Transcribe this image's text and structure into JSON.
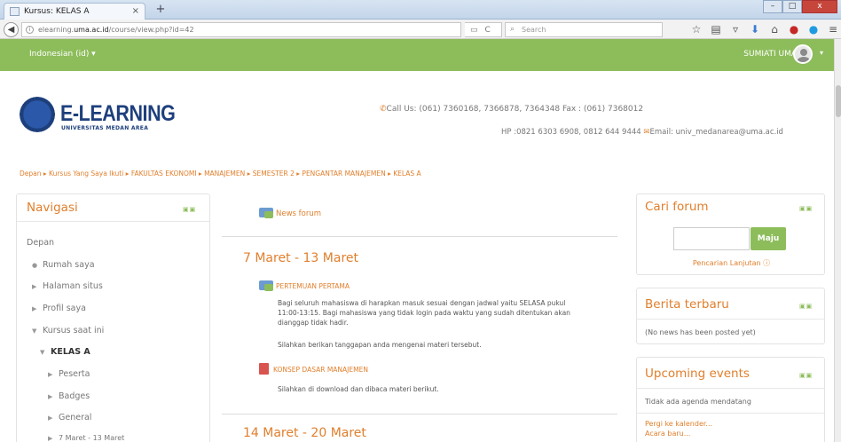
{
  "browser": {
    "tab_title": "Kursus: KELAS A",
    "tab_close": "×",
    "new_tab": "+",
    "url_prefix": "elearning.",
    "url_domain": "uma.ac.id",
    "url_path": "/course/view.php?id=42",
    "search_placeholder": "Search",
    "win_min": "–",
    "win_max": "□",
    "win_close": "x"
  },
  "header": {
    "language": "Indonesian (id) ▾",
    "user_name": "SUMIATI UMA",
    "user_caret": "▾"
  },
  "brand": {
    "title": "E-LEARNING",
    "subtitle": "UNIVERSITAS MEDAN AREA",
    "contact_line1": "Call Us: (061) 7360168, 7366878, 7364348 Fax : (061) 7368012",
    "contact_line2_prefix": "HP :0821 6303 6908, 0812 644 9444",
    "contact_line2_email": "Email: univ_medanarea@uma.ac.id"
  },
  "breadcrumb": "Depan ▸ Kursus Yang Saya Ikuti ▸ FAKULTAS EKONOMI ▸ MANAJEMEN ▸ SEMESTER 2 ▸ PENGANTAR MANAJEMEN ▸ KELAS A",
  "navigation": {
    "title": "Navigasi",
    "items": [
      {
        "label": "Depan"
      },
      {
        "label": "Rumah saya",
        "bullet": "●"
      },
      {
        "label": "Halaman situs",
        "bullet": "▶"
      },
      {
        "label": "Profil saya",
        "bullet": "▶"
      },
      {
        "label": "Kursus saat ini",
        "bullet": "▼"
      },
      {
        "label": "KELAS A",
        "bullet": "▼"
      },
      {
        "label": "Peserta",
        "bullet": "▶"
      },
      {
        "label": "Badges",
        "bullet": "▶"
      },
      {
        "label": "General",
        "bullet": "▶"
      },
      {
        "label": "7 Maret - 13 Maret",
        "bullet": "▶"
      }
    ]
  },
  "main": {
    "news_forum": "News forum",
    "sections": [
      {
        "title": "7 Maret - 13 Maret",
        "activity1": "PERTEMUAN PERTAMA",
        "summary1": "Bagi seluruh mahasiswa di harapkan masuk sesuai dengan jadwal yaitu SELASA pukul 11:00-13:15. Bagi mahasiswa yang tidak login pada waktu yang sudah ditentukan akan dianggap tidak hadir.",
        "summary2": "Silahkan berikan tanggapan anda mengenai materi tersebut.",
        "activity2": "KONSEP DASAR MANAJEMEN",
        "summary3": "Silahkan di download dan dibaca materi berikut."
      },
      {
        "title": "14 Maret - 20 Maret"
      }
    ]
  },
  "cari_forum": {
    "title": "Cari forum",
    "button": "Maju",
    "advanced": "Pencarian Lanjutan ⓘ"
  },
  "berita": {
    "title": "Berita terbaru",
    "empty": "(No news has been posted yet)"
  },
  "events": {
    "title": "Upcoming events",
    "empty": "Tidak ada agenda mendatang",
    "link1": "Pergi ke kalender...",
    "link2": "Acara baru..."
  },
  "block_controls": "▣▣",
  "colors": {
    "accent": "#e07f2c",
    "header_green": "#8dbd5b",
    "brand_blue": "#1d3f7c"
  }
}
